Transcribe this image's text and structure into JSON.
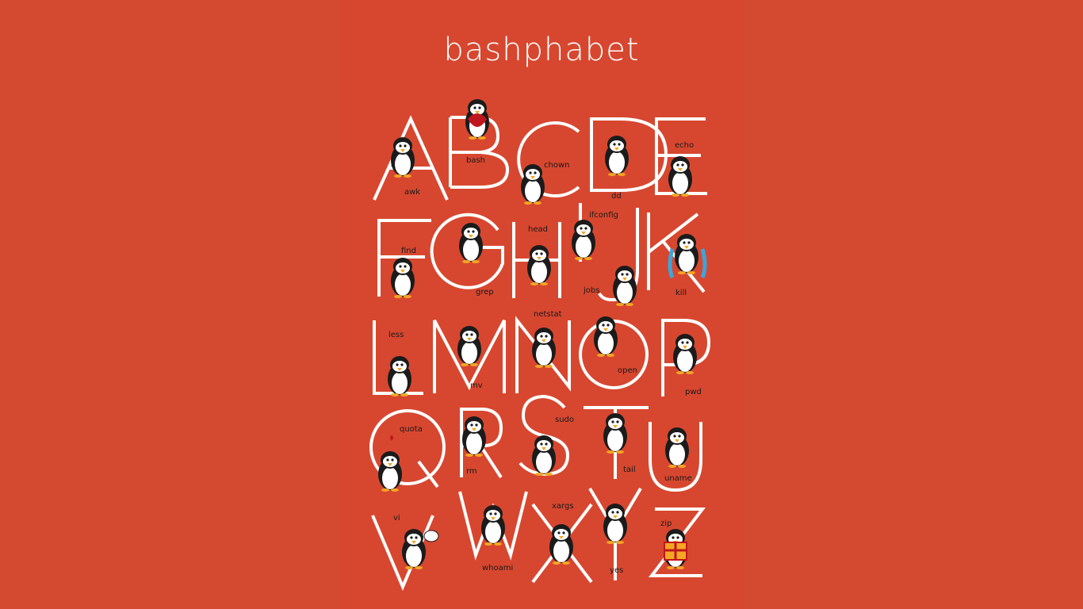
{
  "title": "bashphabet",
  "colors": {
    "background": "#d44a30",
    "letter_stroke": "#ffffff",
    "label": "#1a1a1a"
  },
  "letters": [
    "A",
    "B",
    "C",
    "D",
    "E",
    "F",
    "G",
    "H",
    "I",
    "J",
    "K",
    "L",
    "M",
    "N",
    "O",
    "P",
    "Q",
    "R",
    "S",
    "T",
    "U",
    "V",
    "W",
    "X",
    "Y",
    "Z"
  ],
  "commands": {
    "a": "awk",
    "b": "bash",
    "c": "chown",
    "d": "dd",
    "e": "echo",
    "f": "find",
    "g": "grep",
    "h": "head",
    "i": "ifconfig",
    "j": "jobs",
    "k": "kill",
    "l": "less",
    "m": "mv",
    "n": "netstat",
    "o": "open",
    "p": "pwd",
    "q": "quota",
    "r": "rm",
    "s": "sudo",
    "t": "tail",
    "u": "uname",
    "v": "vi",
    "w": "whoami",
    "x": "xargs",
    "y": "yes",
    "z": "zip"
  }
}
